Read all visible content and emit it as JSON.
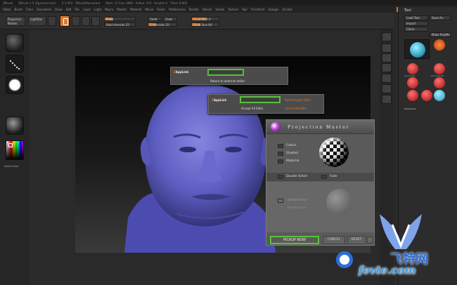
{
  "titlebar": {
    "app": "ZBrush",
    "items": [
      "ZBrush 3.5 (Zgarenet.edu)",
      "Z 3.5R3 · ZBrushDocument",
      "Mem: 11 Free 1866 · Active: 219 · Scratch 4 · Timer 0.003"
    ]
  },
  "menubar": {
    "items": [
      "Alpha",
      "Brush",
      "Color",
      "Document",
      "Draw",
      "Edit",
      "File",
      "Layer",
      "Light",
      "Macro",
      "Marker",
      "Material",
      "Movie",
      "Picker",
      "Preferences",
      "Render",
      "Stencil",
      "Stroke",
      "Texture",
      "Tool",
      "Transform",
      "Zplugin",
      "Zscript"
    ],
    "script_label": "Script",
    "default_script": "DefaultZScript"
  },
  "toolbar": {
    "projection_master": "Projection Master",
    "lightbox": "LightBox",
    "quick_sketch": "Quick Sketch",
    "edit": "Edit",
    "draw": "Draw",
    "move": "Move",
    "scale": "Scale",
    "rotate": "Rotate",
    "mrgb": "Mrgb",
    "rgb": "Rgb",
    "m": "M",
    "zadd": "Zadd",
    "zsub": "Zsub",
    "rgb_intensity": "Rgb Intensity 25",
    "z_intensity": "Z Intensity 25",
    "focal_shift": "Focal Shift 0",
    "draw_size": "Draw Size 64",
    "rgb_intensity_level": 0.25,
    "z_intensity_level": 0.25,
    "focal_shift_level": 0.5,
    "draw_size_level": 0.3
  },
  "dialogs": {
    "return_external": "Return to external editor",
    "cancel_layer_edits": "Cancel Layer Edits",
    "accept_all_edits": "Accept All Edits",
    "cancel_all_edits": "Cancel All Edits"
  },
  "projection_master": {
    "title": "Projection Master",
    "colors": "Colors",
    "shaded": "Shaded",
    "material": "Material",
    "double_sided": "Double Sided",
    "fade": "Fade",
    "deformation": "Deformation",
    "normalized": "Normalized",
    "pickup_now": "PICKUP NOW",
    "cancel": "CANCEL",
    "reset": "RESET"
  },
  "tool_panel": {
    "title": "Tool",
    "load_tool": "Load Tool",
    "save_as": "Save As",
    "import": "Import",
    "export": "Export",
    "clone": "Clone",
    "make_polymesh": "Make PolyMesh3D",
    "current_tool": "PolySphere",
    "tools": [
      "SimpleBrush",
      "Sphere3D",
      "PolyMesh3D",
      "Cylinder3D",
      "Cube3D",
      "Cone3D",
      "Ring3D",
      "PolySphere"
    ]
  },
  "left_shelf": {
    "texture_label": "SwitchColor"
  },
  "watermark": {
    "text": "fevte.com",
    "cn": "飞特网"
  },
  "colors": {
    "accent": "#e0782a",
    "highlight": "#58c23a",
    "head": "#6666c8"
  }
}
